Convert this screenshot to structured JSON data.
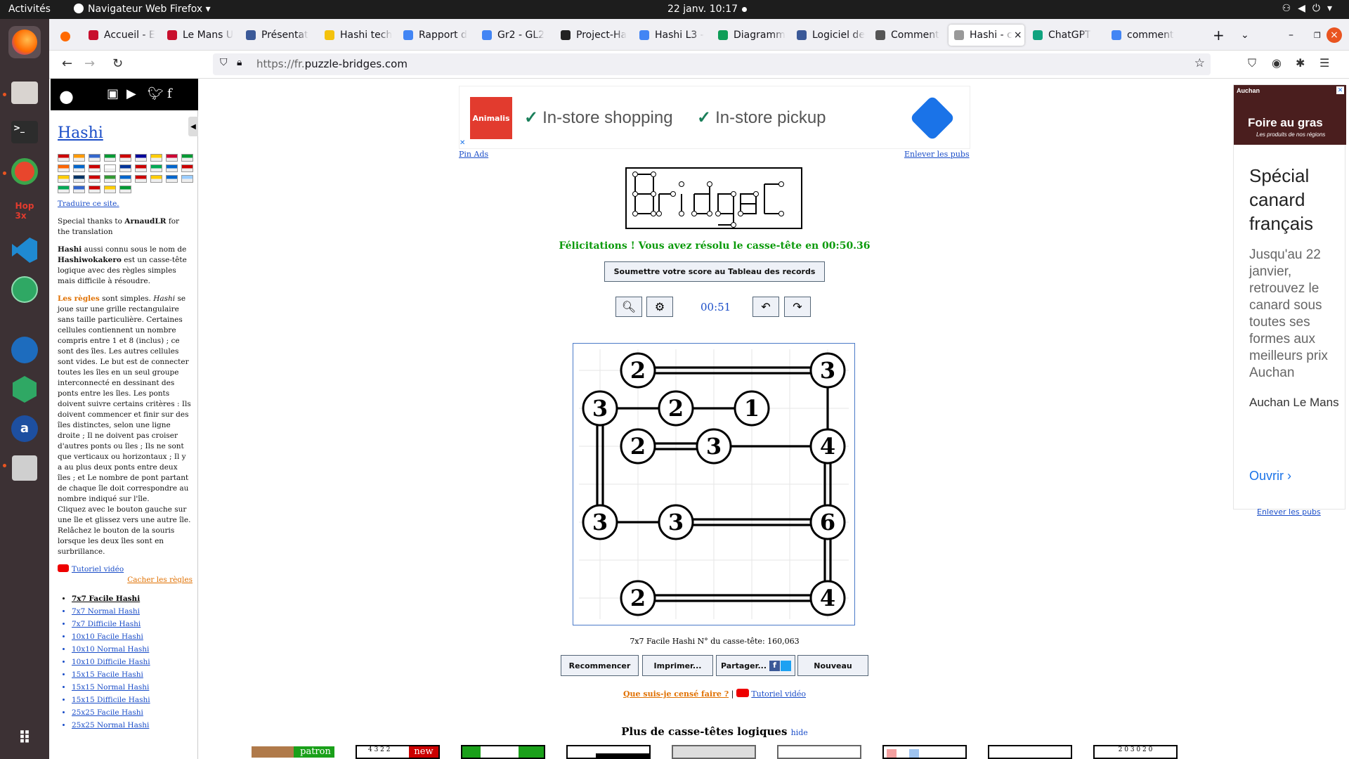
{
  "system": {
    "activities": "Activités",
    "app_name": "Navigateur Web Firefox",
    "clock": "22 janv.  10:17"
  },
  "tabs": [
    {
      "label": "Accueil - E",
      "color": "#c8102e"
    },
    {
      "label": "Le Mans U",
      "color": "#c8102e"
    },
    {
      "label": "Présentat",
      "color": "#3b5998"
    },
    {
      "label": "Hashi tech",
      "color": "#f4c20d"
    },
    {
      "label": "Rapport d",
      "color": "#4285f4"
    },
    {
      "label": "Gr2 - GL2",
      "color": "#4285f4"
    },
    {
      "label": "Project-Ha",
      "color": "#222222"
    },
    {
      "label": "Hashi L3 -",
      "color": "#4285f4"
    },
    {
      "label": "Diagramm",
      "color": "#0f9d58"
    },
    {
      "label": "Logiciel de",
      "color": "#3b5998"
    },
    {
      "label": "Comment",
      "color": "#555555"
    },
    {
      "label": "Hashi - c",
      "color": "#999999"
    },
    {
      "label": "ChatGPT",
      "color": "#10a37f"
    },
    {
      "label": "comment",
      "color": "#4285f4"
    }
  ],
  "url": {
    "prefix": "https://fr.",
    "domain": "puzzle-bridges.com"
  },
  "sidebar": {
    "title": "Hashi",
    "translate": "Traduire ce site.",
    "thanks_pre": "Special thanks to ",
    "thanks_name": "ArnaudLR",
    "thanks_post": " for the translation",
    "intro_bold1": "Hashi",
    "intro_mid": " aussi connu sous le nom de ",
    "intro_bold2": "Hashiwokakero",
    "intro_end": " est un casse-tête logique avec des règles simples mais difficile à résoudre.",
    "rules_label": "Les règles",
    "rules_mid": " sont simples. ",
    "rules_italic": "Hashi",
    "rules_text": " se joue sur une grille rectangulaire sans taille particulière. Certaines cellules contiennent un nombre compris entre 1 et 8 (inclus) ; ce sont des îles. Les autres cellules sont vides. Le but est de connecter toutes les îles en un seul groupe interconnecté en dessinant des ponts entre les îles. Les ponts doivent suivre certains critères : Ils doivent commencer et finir sur des îles distinctes, selon une ligne droite ; Il ne doivent pas croiser d'autres ponts ou îles ; Ils ne sont que verticaux ou horizontaux ; Il y a au plus deux ponts entre deux îles ; et Le nombre de pont partant de chaque île doit correspondre au nombre indiqué sur l'île.",
    "rules_click": "Cliquez avec le bouton gauche sur une île et glissez vers une autre île. Relâchez le bouton de la souris lorsque les deux îles sont en surbrillance.",
    "video": "Tutoriel vidéo",
    "hide_rules": "Cacher les règles",
    "levels": [
      "7x7 Facile Hashi",
      "7x7 Normal Hashi",
      "7x7 Difficile Hashi",
      "10x10 Facile Hashi",
      "10x10 Normal Hashi",
      "10x10 Difficile Hashi",
      "15x15 Facile Hashi",
      "15x15 Normal Hashi",
      "15x15 Difficile Hashi",
      "25x25 Facile Hashi",
      "25x25 Normal Hashi"
    ]
  },
  "ad_top": {
    "brand": "Animalis",
    "item1": "In-store shopping",
    "item2": "In-store pickup",
    "pin": "Pin Ads",
    "remove": "Enlever les pubs"
  },
  "status": {
    "congrats": "Félicitations ! Vous avez résolu le casse-tête en 00:50.36",
    "submit": "Soumettre votre score au Tableau des records",
    "timer": "00:51"
  },
  "puzzle": {
    "info": "7x7 Facile Hashi N° du casse-tête: 160,063",
    "islands": [
      {
        "c": 1,
        "r": 0,
        "n": 2
      },
      {
        "c": 6,
        "r": 0,
        "n": 3
      },
      {
        "c": 0,
        "r": 1,
        "n": 3
      },
      {
        "c": 2,
        "r": 1,
        "n": 2
      },
      {
        "c": 4,
        "r": 1,
        "n": 1
      },
      {
        "c": 1,
        "r": 2,
        "n": 2
      },
      {
        "c": 3,
        "r": 2,
        "n": 3
      },
      {
        "c": 6,
        "r": 2,
        "n": 4
      },
      {
        "c": 0,
        "r": 4,
        "n": 3
      },
      {
        "c": 2,
        "r": 4,
        "n": 3
      },
      {
        "c": 6,
        "r": 4,
        "n": 6
      },
      {
        "c": 1,
        "r": 6,
        "n": 2
      },
      {
        "c": 6,
        "r": 6,
        "n": 4
      }
    ],
    "bridges": [
      {
        "a": 0,
        "b": 1,
        "k": 2
      },
      {
        "a": 1,
        "b": 7,
        "k": 1
      },
      {
        "a": 2,
        "b": 3,
        "k": 1
      },
      {
        "a": 3,
        "b": 4,
        "k": 1
      },
      {
        "a": 2,
        "b": 8,
        "k": 2
      },
      {
        "a": 5,
        "b": 6,
        "k": 2
      },
      {
        "a": 6,
        "b": 7,
        "k": 1
      },
      {
        "a": 7,
        "b": 10,
        "k": 2
      },
      {
        "a": 8,
        "b": 9,
        "k": 1
      },
      {
        "a": 9,
        "b": 10,
        "k": 2
      },
      {
        "a": 10,
        "b": 12,
        "k": 2
      },
      {
        "a": 11,
        "b": 12,
        "k": 2
      }
    ]
  },
  "actions": {
    "restart": "Recommencer",
    "print": "Imprimer...",
    "share": "Partager...",
    "new": "Nouveau"
  },
  "help": {
    "what": "Que suis-je censé faire ?",
    "video": "Tutoriel vidéo"
  },
  "more": {
    "title": "Plus de casse-têtes logiques",
    "hide": "hide",
    "thumb1": "patron",
    "thumb2": "new",
    "thumb2_nums": "4 3 2 2",
    "thumb8": "2 0 3 0 2 0"
  },
  "ad_right": {
    "brand": "Auchan",
    "banner": "Foire au gras",
    "banner_sub": "Les produits de nos régions",
    "headline": "Spécial canard français",
    "body": "Jusqu'au 22 janvier, retrouvez le canard sous toutes ses formes aux meilleurs prix Auchan",
    "store": "Auchan Le Mans",
    "cta": "Ouvrir",
    "remove": "Enlever les pubs"
  }
}
